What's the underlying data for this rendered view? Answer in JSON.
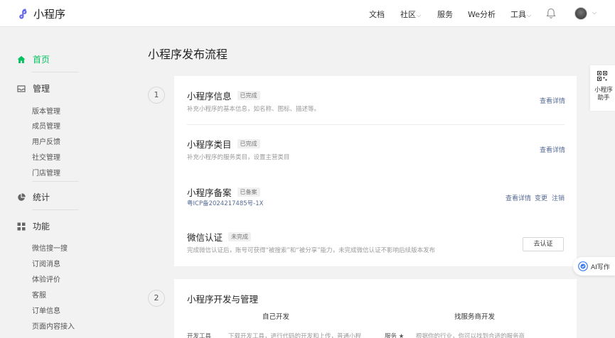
{
  "header": {
    "logo_text": "小程序",
    "nav": [
      {
        "label": "文档",
        "has_caret": false
      },
      {
        "label": "社区",
        "has_caret": true
      },
      {
        "label": "服务",
        "has_caret": false
      },
      {
        "label": "We分析",
        "has_caret": false
      },
      {
        "label": "工具",
        "has_caret": true
      }
    ],
    "caret": "⌵"
  },
  "sidebar": {
    "home": "首页",
    "manage": "管理",
    "manage_items": [
      "版本管理",
      "成员管理",
      "用户反馈",
      "社交管理",
      "门店管理"
    ],
    "stats": "统计",
    "features": "功能",
    "feature_items": [
      "微信搜一搜",
      "订阅消息",
      "体验评价",
      "客服",
      "订单信息",
      "页面内容接入"
    ]
  },
  "main": {
    "title": "小程序发布流程",
    "step1": {
      "number": "1",
      "rows": [
        {
          "title": "小程序信息",
          "tag": "已完成",
          "desc": "补充小程序的基本信息，如名称、图标、描述等。",
          "link": "查看详情"
        },
        {
          "title": "小程序类目",
          "tag": "已完成",
          "desc": "补充小程序的服务类目，设置主营类目",
          "link": "查看详情"
        },
        {
          "title": "小程序备案",
          "tag": "已备案",
          "desc": "粤ICP备2024217485号-1X",
          "links": [
            "查看详情",
            "变更",
            "注销"
          ]
        },
        {
          "title": "微信认证",
          "tag": "未完成",
          "desc": "完成微信认证后，账号可获得“被搜索”和“被分享”能力，未完成微信认证不影响后续版本发布",
          "button": "去认证"
        }
      ]
    },
    "step2": {
      "number": "2",
      "title": "小程序开发与管理",
      "col1": "自己开发",
      "col2": "找服务商开发",
      "clip1": "开发工具",
      "clip2": "下载开发工具，进行代码的开发和上传，普通小程",
      "clip3": "服务 ★",
      "clip4": "根据你的行业，你可以找到合适的服务商"
    }
  },
  "widgets": {
    "qr_label": "小程序助手",
    "ai_label": "AI写作"
  },
  "colors": {
    "accent": "#07c160",
    "link": "#576b95"
  }
}
